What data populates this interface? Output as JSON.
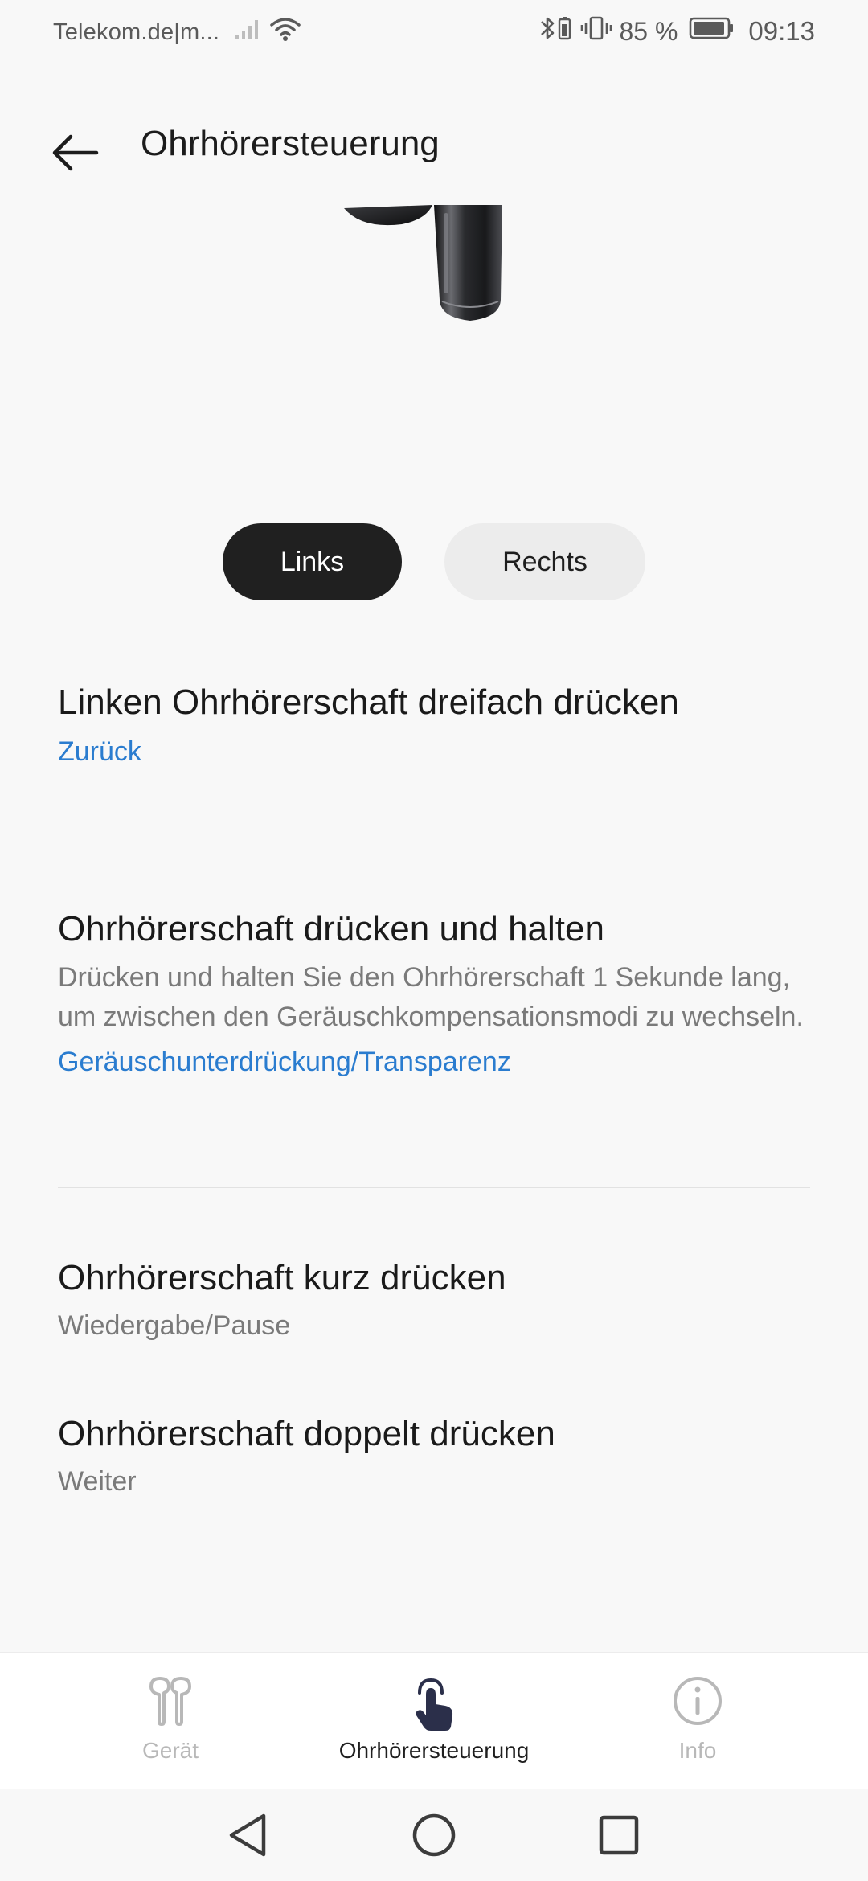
{
  "status_bar": {
    "carrier": "Telekom.de|m...",
    "battery_percent": "85 %",
    "time": "09:13"
  },
  "header": {
    "title": "Ohrhörersteuerung",
    "back_icon": "back-arrow-icon"
  },
  "side_toggle": {
    "left_label": "Links",
    "right_label": "Rechts",
    "selected": "Links"
  },
  "settings": [
    {
      "title": "Linken Ohrhörerschaft dreifach drücken",
      "value": "Zurück"
    },
    {
      "title": "Ohrhörerschaft drücken und halten",
      "description": "Drücken und halten Sie den Ohrhörerschaft 1 Sekunde lang, um zwischen den Geräuschkompensationsmodi zu wechseln.",
      "value": "Geräuschunterdrückung/Transparenz"
    },
    {
      "title": "Ohrhörerschaft kurz drücken",
      "value": "Wiedergabe/Pause"
    },
    {
      "title": "Ohrhörerschaft doppelt drücken",
      "value": "Weiter"
    }
  ],
  "bottom_nav": {
    "items": [
      {
        "label": "Gerät",
        "icon": "earbuds-icon",
        "active": false
      },
      {
        "label": "Ohrhörersteuerung",
        "icon": "tap-gesture-icon",
        "active": true
      },
      {
        "label": "Info",
        "icon": "info-icon",
        "active": false
      }
    ]
  },
  "colors": {
    "accent_link": "#2a7ccf",
    "selected_tab": "#202020",
    "unselected_tab": "#ececec",
    "background": "#f8f8f8"
  }
}
